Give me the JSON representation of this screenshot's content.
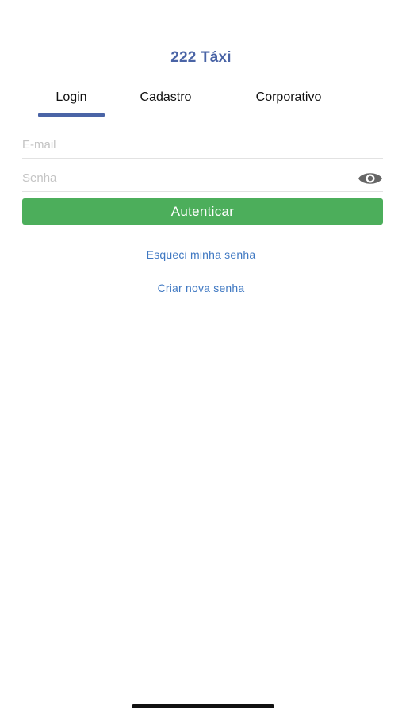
{
  "header": {
    "title": "222 Táxi"
  },
  "tabs": [
    {
      "label": "Login",
      "active": true
    },
    {
      "label": "Cadastro",
      "active": false
    },
    {
      "label": "Corporativo",
      "active": false
    }
  ],
  "form": {
    "email": {
      "value": "",
      "placeholder": "E-mail"
    },
    "password": {
      "value": "",
      "placeholder": "Senha",
      "toggle_icon": "eye-icon"
    },
    "submit_label": "Autenticar"
  },
  "links": {
    "forgot_password": "Esqueci minha senha",
    "create_password": "Criar nova senha"
  },
  "colors": {
    "brand": "#4a64a6",
    "button": "#4cae5b",
    "link": "#3f78c2"
  }
}
